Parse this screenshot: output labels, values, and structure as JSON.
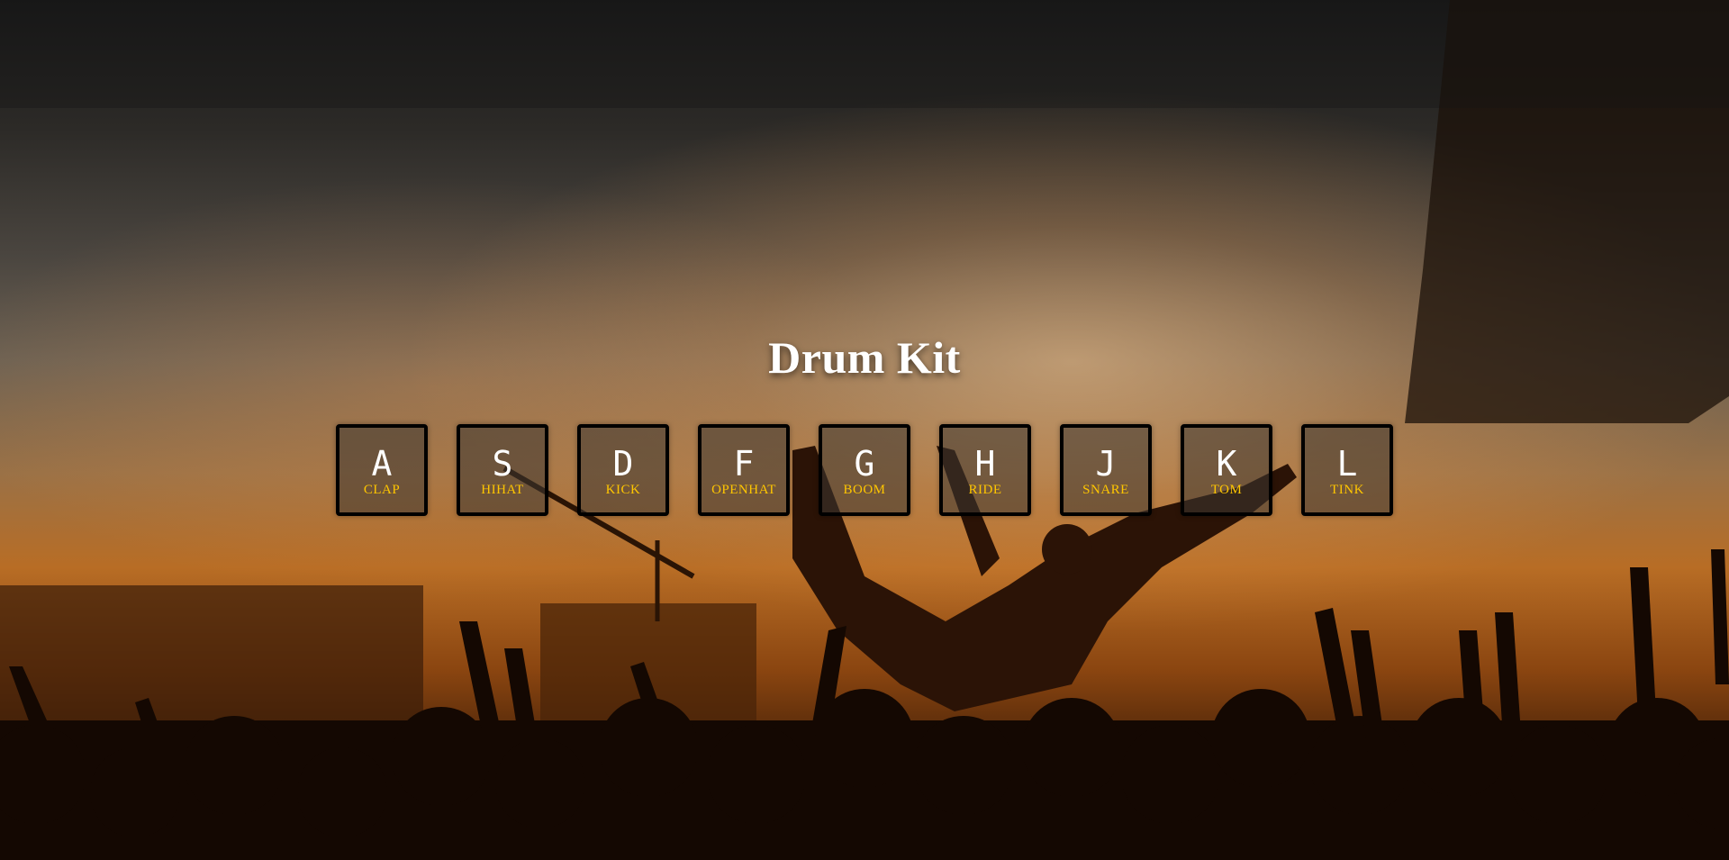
{
  "app": {
    "title": "Drum Kit"
  },
  "keys": [
    {
      "letter": "A",
      "sound": "CLAP"
    },
    {
      "letter": "S",
      "sound": "HIHAT"
    },
    {
      "letter": "D",
      "sound": "KICK"
    },
    {
      "letter": "F",
      "sound": "OPENHAT"
    },
    {
      "letter": "G",
      "sound": "BOOM"
    },
    {
      "letter": "H",
      "sound": "RIDE"
    },
    {
      "letter": "J",
      "sound": "SNARE"
    },
    {
      "letter": "K",
      "sound": "TOM"
    },
    {
      "letter": "L",
      "sound": "TINK"
    }
  ],
  "colors": {
    "sound_label": "#ffc600",
    "key_letter": "#ffffff",
    "key_border": "#000000"
  }
}
